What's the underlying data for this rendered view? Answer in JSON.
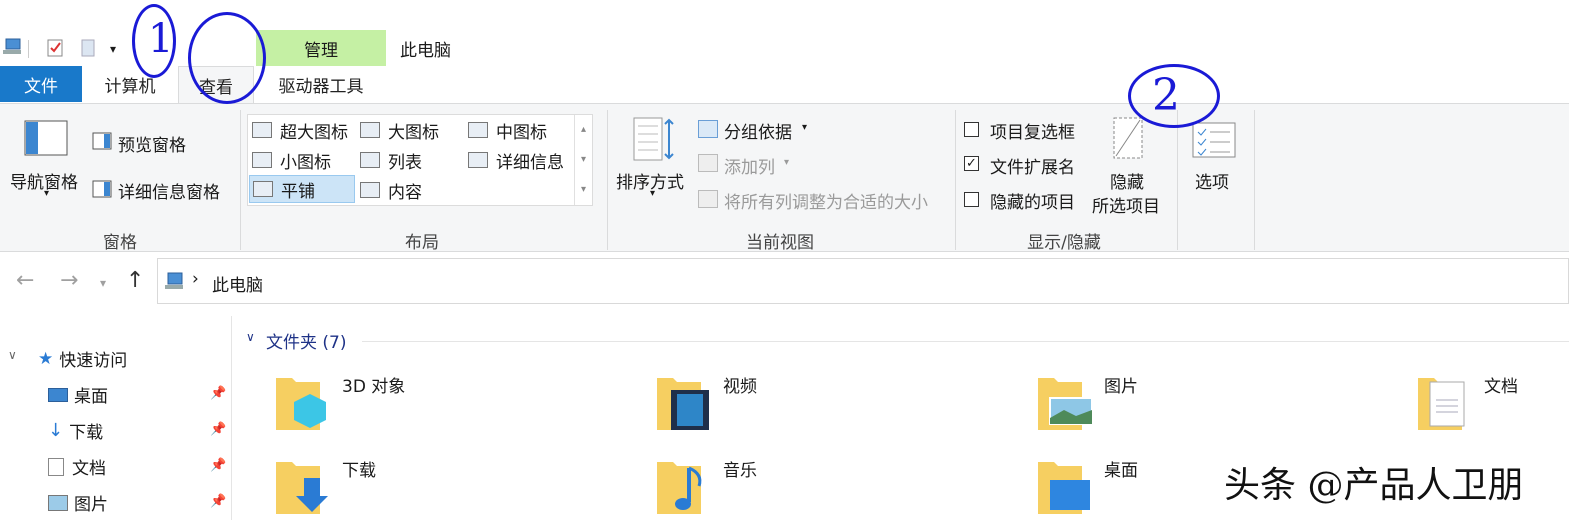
{
  "title_bar": {
    "context_tab": "管理",
    "window_title": "此电脑"
  },
  "tabs": {
    "file": "文件",
    "computer": "计算机",
    "view": "查看",
    "drive_tools": "驱动器工具"
  },
  "ribbon": {
    "panes": {
      "label": "窗格",
      "nav_pane": "导航窗格",
      "preview_pane": "预览窗格",
      "details_pane": "详细信息窗格"
    },
    "layout": {
      "label": "布局",
      "items": [
        "超大图标",
        "大图标",
        "中图标",
        "小图标",
        "列表",
        "详细信息",
        "平铺",
        "内容"
      ],
      "selected": "平铺"
    },
    "current_view": {
      "label": "当前视图",
      "sort_by": "排序方式",
      "group_by": "分组依据",
      "add_column": "添加列",
      "size_all_columns": "将所有列调整为合适的大小"
    },
    "show_hide": {
      "label": "显示/隐藏",
      "item_checkboxes": "项目复选框",
      "item_checkboxes_checked": false,
      "file_extensions": "文件扩展名",
      "file_extensions_checked": true,
      "hidden_items": "隐藏的项目",
      "hidden_items_checked": false,
      "hide_selected_line1": "隐藏",
      "hide_selected_line2": "所选项目"
    },
    "options": "选项"
  },
  "address": {
    "separator": "›",
    "location": "此电脑"
  },
  "sidebar": {
    "quick_access": "快速访问",
    "items": [
      "桌面",
      "下载",
      "文档",
      "图片"
    ]
  },
  "content": {
    "section_title": "文件夹 (7)",
    "folders": [
      "3D 对象",
      "视频",
      "图片",
      "文档",
      "下载",
      "音乐",
      "桌面"
    ]
  },
  "annotations": {
    "one": "1",
    "two": "2"
  },
  "watermark": "头条 @产品人卫朋",
  "colors": {
    "accent": "#1979ca",
    "context_tab": "#c5f0a4",
    "annotation_ink": "#1a1ad6"
  }
}
